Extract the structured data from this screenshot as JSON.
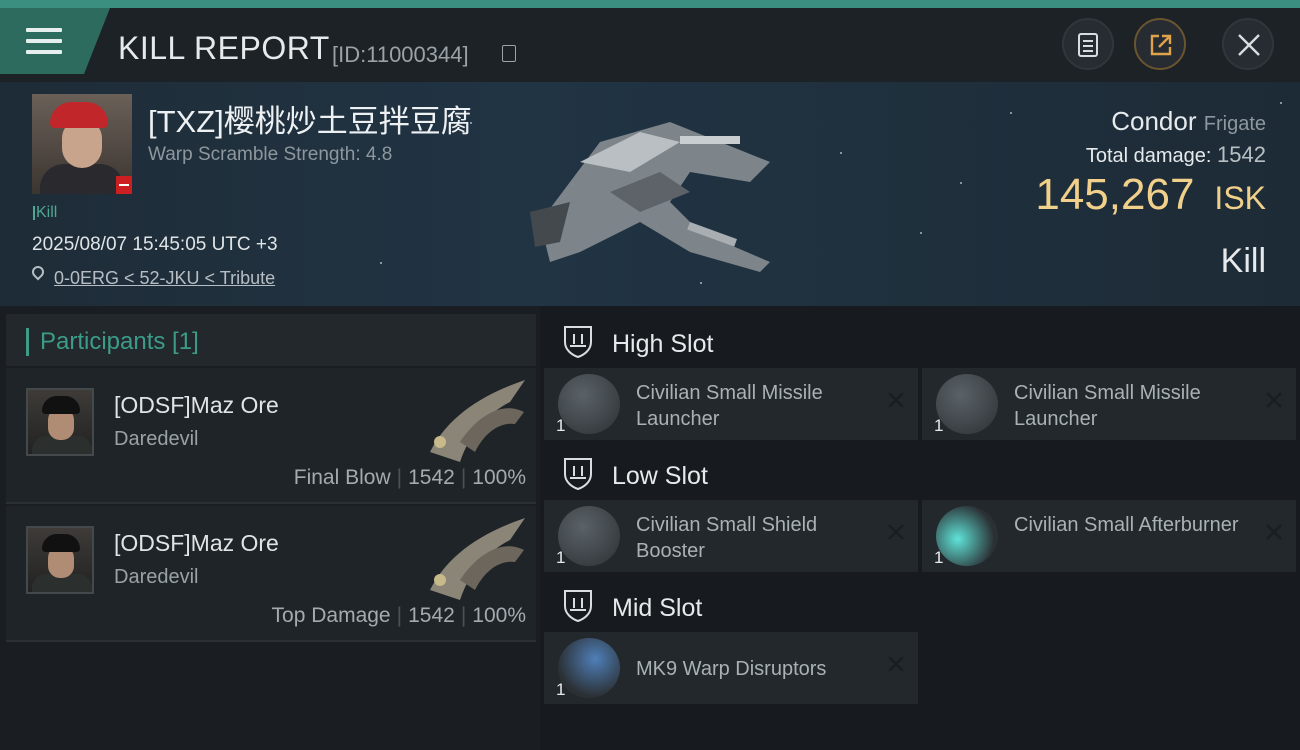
{
  "header": {
    "title": "KILL REPORT",
    "report_id": "[ID:11000344]"
  },
  "victim": {
    "name": "[TXZ]樱桃炒土豆拌豆腐",
    "warp_scramble": "Warp Scramble Strength: 4.8",
    "kill_tag": "Kill",
    "datetime": "2025/08/07 15:45:05 UTC +3",
    "location": "0-0ERG < 52-JKU < Tribute",
    "ship_name": "Condor",
    "ship_class": "Frigate",
    "total_damage_label": "Total damage:",
    "total_damage": "1542",
    "isk_value": "145,267",
    "isk_unit": "ISK",
    "result": "Kill"
  },
  "participants": {
    "header": "Participants [1]",
    "rows": [
      {
        "name": "[ODSF]Maz Ore",
        "ship": "Daredevil",
        "role": "Final Blow",
        "damage": "1542",
        "percent": "100%"
      },
      {
        "name": "[ODSF]Maz Ore",
        "ship": "Daredevil",
        "role": "Top Damage",
        "damage": "1542",
        "percent": "100%"
      }
    ]
  },
  "fitting": {
    "high": {
      "label": "High Slot",
      "modules": [
        {
          "name": "Civilian Small Missile Launcher",
          "qty": "1"
        },
        {
          "name": "Civilian Small Missile Launcher",
          "qty": "1"
        }
      ]
    },
    "low": {
      "label": "Low Slot",
      "modules": [
        {
          "name": "Civilian Small Shield Booster",
          "qty": "1"
        },
        {
          "name": "Civilian Small Afterburner",
          "qty": "1"
        }
      ]
    },
    "mid": {
      "label": "Mid Slot",
      "modules": [
        {
          "name": "MK9 Warp Disruptors",
          "qty": "1"
        }
      ]
    }
  },
  "colors": {
    "accent": "#3c9c88",
    "isk": "#f0d08a",
    "victim_badge": "#cc1f22"
  },
  "icons": [
    "menu-icon",
    "copy-icon",
    "clipboard-icon",
    "share-icon",
    "close-icon",
    "location-pin-icon",
    "slot-shield-icon",
    "remove-x-icon"
  ]
}
